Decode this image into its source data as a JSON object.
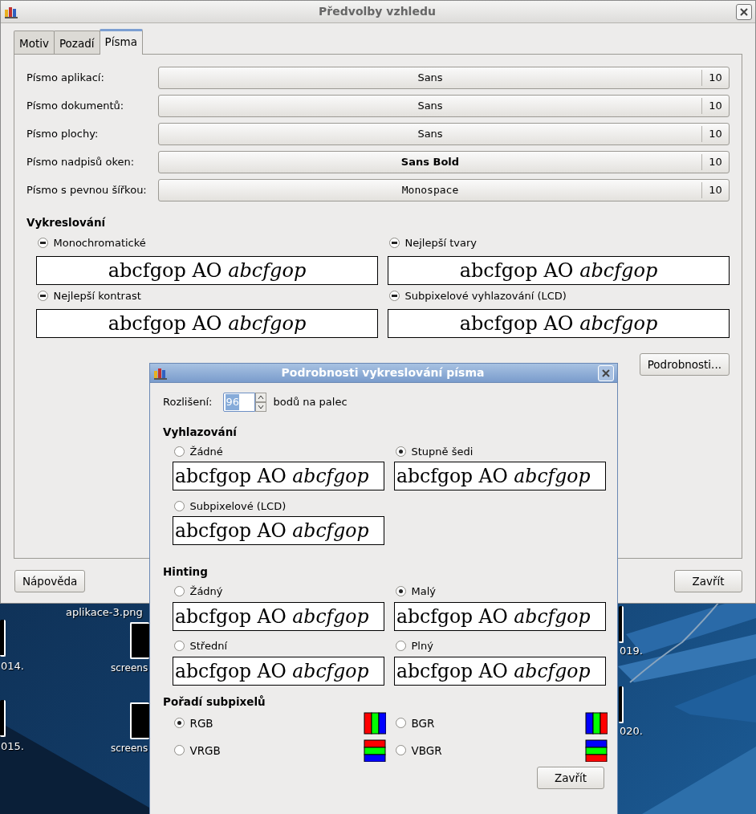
{
  "desktop": {
    "items": [
      {
        "label": "aplikace-3.png"
      },
      {
        "label": "014."
      },
      {
        "label": "screens"
      },
      {
        "label": "015."
      },
      {
        "label": "screens"
      },
      {
        "label": "019."
      },
      {
        "label": "020."
      }
    ]
  },
  "main_window": {
    "title": "Předvolby vzhledu",
    "tabs": [
      {
        "label": "Motiv",
        "selected": false
      },
      {
        "label": "Pozadí",
        "selected": false
      },
      {
        "label": "Písma",
        "selected": true
      }
    ],
    "font_rows": [
      {
        "label": "Písmo aplikací:",
        "font": "Sans",
        "size": "10",
        "kind": "regular"
      },
      {
        "label": "Písmo dokumentů:",
        "font": "Sans",
        "size": "10",
        "kind": "regular"
      },
      {
        "label": "Písmo plochy:",
        "font": "Sans",
        "size": "10",
        "kind": "regular"
      },
      {
        "label": "Písmo nadpisů oken:",
        "font": "Sans Bold",
        "size": "10",
        "kind": "bold"
      },
      {
        "label": "Písmo s pevnou šířkou:",
        "font": "Monospace",
        "size": "10",
        "kind": "mono"
      }
    ],
    "rendering": {
      "heading": "Vykreslování",
      "options": [
        {
          "label": "Monochromatické",
          "inconsistent": true,
          "preview": "abcfgop AO *abcfgop*"
        },
        {
          "label": "Nejlepší tvary",
          "inconsistent": true,
          "preview": "abcfgop AO *abcfgop*"
        },
        {
          "label": "Nejlepší kontrast",
          "inconsistent": true,
          "preview": "abcfgop AO *abcfgop*"
        },
        {
          "label": "Subpixelové vyhlazování (LCD)",
          "inconsistent": true,
          "preview": "abcfgop AO *abcfgop*"
        }
      ]
    },
    "details_button": "Podrobnosti...",
    "help_button": "Nápověda",
    "close_button": "Zavřít"
  },
  "dialog": {
    "title": "Podrobnosti vykreslování písma",
    "resolution": {
      "label": "Rozlišení:",
      "value": "96",
      "unit": "bodů na palec"
    },
    "sections": [
      {
        "heading": "Vyhlazování",
        "options": [
          {
            "label": "Žádné",
            "selected": false,
            "preview": "abcfgop AO *abcfgop*"
          },
          {
            "label": "Stupně šedi",
            "selected": true,
            "preview": "abcfgop AO *abcfgop*"
          },
          {
            "label": "Subpixelové (LCD)",
            "selected": false,
            "preview": "abcfgop AO *abcfgop*"
          }
        ]
      },
      {
        "heading": "Hinting",
        "options": [
          {
            "label": "Žádný",
            "selected": false,
            "preview": "abcfgop AO *abcfgop*"
          },
          {
            "label": "Malý",
            "selected": true,
            "preview": "abcfgop AO *abcfgop*"
          },
          {
            "label": "Střední",
            "selected": false,
            "preview": "abcfgop AO *abcfgop*"
          },
          {
            "label": "Plný",
            "selected": false,
            "preview": "abcfgop AO *abcfgop*"
          }
        ]
      }
    ],
    "subpixel": {
      "heading": "Pořadí subpixelů",
      "options": [
        {
          "label": "RGB",
          "selected": true,
          "kind": "rgb"
        },
        {
          "label": "BGR",
          "selected": false,
          "kind": "bgr"
        },
        {
          "label": "VRGB",
          "selected": false,
          "kind": "vrgb"
        },
        {
          "label": "VBGR",
          "selected": false,
          "kind": "vbgr"
        }
      ]
    },
    "close_button": "Zavřít"
  }
}
